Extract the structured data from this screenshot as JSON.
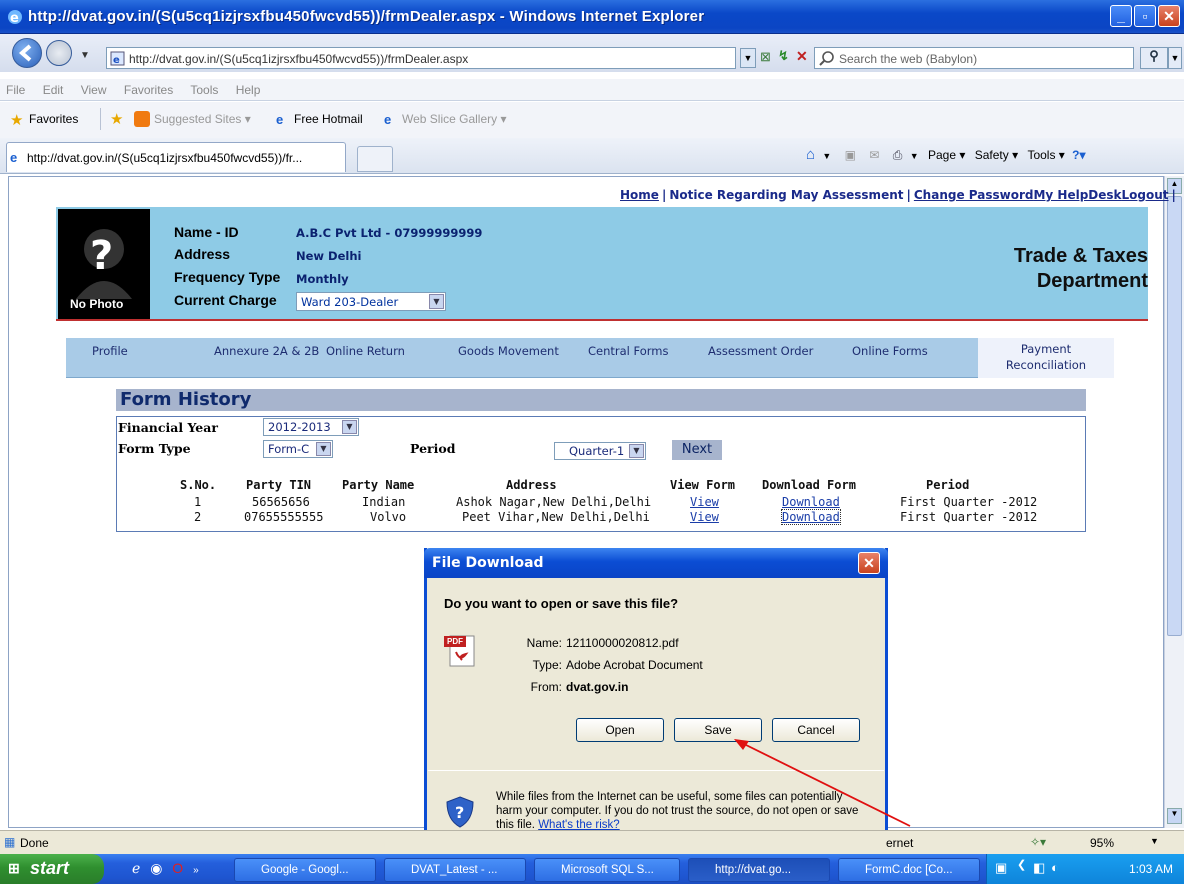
{
  "window": {
    "title": "http://dvat.gov.in/(S(u5cq1izjrsxfbu450fwcvd55))/frmDealer.aspx - Windows Internet Explorer"
  },
  "browser": {
    "address": "http://dvat.gov.in/(S(u5cq1izjrsxfbu450fwcvd55))/frmDealer.aspx",
    "search_placeholder": "Search the web (Babylon)",
    "menu": [
      "File",
      "Edit",
      "View",
      "Favorites",
      "Tools",
      "Help"
    ],
    "favorites_label": "Favorites",
    "favorites_items": [
      "Suggested Sites ▾",
      "Free Hotmail",
      "Web Slice Gallery ▾"
    ],
    "tab_title": "http://dvat.gov.in/(S(u5cq1izjrsxfbu450fwcvd55))/fr...",
    "command_items": [
      "Page ▾",
      "Safety ▾",
      "Tools ▾"
    ]
  },
  "page": {
    "top_links": {
      "home": "Home",
      "notice": "Notice Regarding May Assessment",
      "change_password": "Change Password",
      "helpdesk": "My HelpDesk",
      "logout": "Logout"
    },
    "profile": {
      "photo_label": "No Photo",
      "name_label": "Name - ID",
      "name_value": "A.B.C Pvt Ltd - 07999999999",
      "address_label": "Address",
      "address_value": "New Delhi",
      "frequency_label": "Frequency Type",
      "frequency_value": "Monthly",
      "charge_label": "Current Charge",
      "charge_value": "Ward 203-Dealer"
    },
    "department": [
      "Trade & Taxes",
      "Department"
    ],
    "nav_tabs": [
      "Profile",
      "Annexure 2A & 2B",
      "Online Return",
      "Goods Movement",
      "Central Forms",
      "Assessment Order",
      "Online Forms"
    ],
    "nav_tab_payment": [
      "Payment",
      "Reconciliation"
    ],
    "form_history": {
      "title": "Form History",
      "financial_year_label": "Financial Year",
      "financial_year_value": "2012-2013",
      "form_type_label": "Form Type",
      "form_type_value": "Form-C",
      "period_label": "Period",
      "period_value": "Quarter-1",
      "next_label": "Next",
      "columns": [
        "S.No.",
        "Party TIN",
        "Party Name",
        "Address",
        "View Form",
        "Download Form",
        "Period"
      ],
      "rows": [
        [
          "1",
          "56565656",
          "Indian",
          "Ashok Nagar,New Delhi,Delhi",
          "View",
          "Download",
          "First Quarter -2012"
        ],
        [
          "2",
          "07655555555",
          "Volvo",
          "Peet Vihar,New Delhi,Delhi",
          "View",
          "Download",
          "First Quarter -2012"
        ]
      ]
    }
  },
  "dialog": {
    "title": "File Download",
    "question": "Do you want to open or save this file?",
    "name_label": "Name:",
    "name_value": "12110000020812.pdf",
    "type_label": "Type:",
    "type_value": "Adobe Acrobat Document",
    "from_label": "From:",
    "from_value": "dvat.gov.in",
    "open_label": "Open",
    "save_label": "Save",
    "cancel_label": "Cancel",
    "warning": "While files from the Internet can be useful, some files can potentially harm your computer. If you do not trust the source, do not open or save this file.",
    "risk_link": "What's the risk?",
    "pdf_badge": "PDF"
  },
  "status": {
    "left": "Done",
    "zone": "ernet",
    "zoom": "95%"
  },
  "taskbar": {
    "start": "start",
    "items": [
      "Google - Googl...",
      "DVAT_Latest - ...",
      "Microsoft SQL S...",
      "http://dvat.go...",
      "FormC.doc [Co..."
    ],
    "clock": "1:03 AM"
  },
  "colors": {
    "header_bg": "#8ecbe6",
    "nav_bg": "#a9cbe7",
    "accent_red": "#c03030",
    "annotation_arrow": "#e01010"
  }
}
